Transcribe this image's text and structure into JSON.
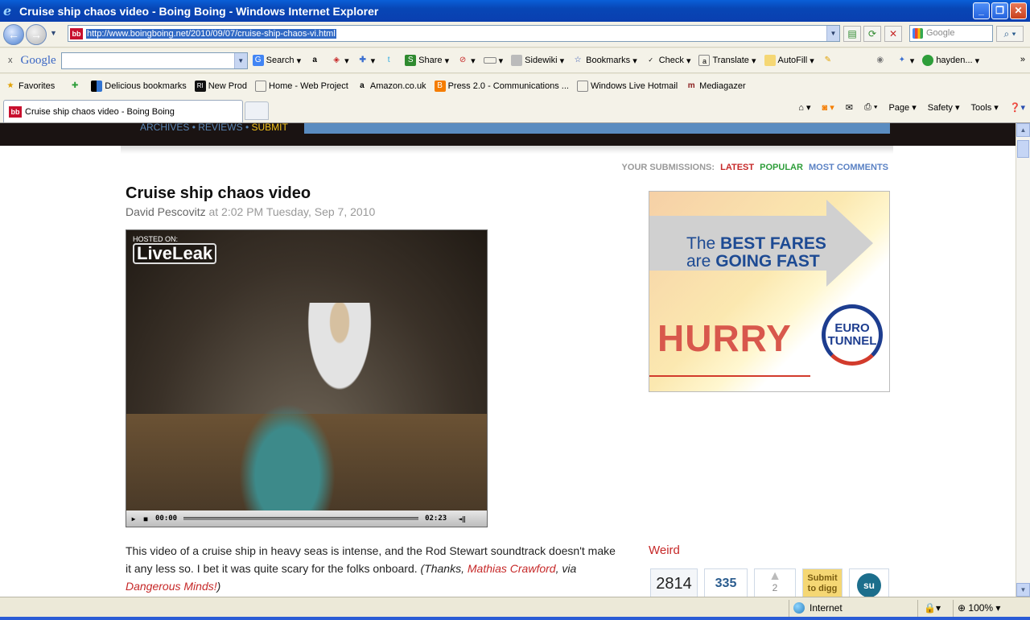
{
  "window": {
    "title": "Cruise ship chaos video - Boing Boing - Windows Internet Explorer"
  },
  "address": {
    "url": "http://www.boingboing.net/2010/09/07/cruise-ship-chaos-vi.html",
    "search_placeholder": "Google"
  },
  "google_toolbar": {
    "close": "x",
    "brand": "Google",
    "items": [
      "Search",
      "Share",
      "Sidewiki",
      "Bookmarks",
      "Check",
      "Translate",
      "AutoFill",
      "hayden..."
    ]
  },
  "favorites": {
    "label": "Favorites",
    "items": [
      "Delicious bookmarks",
      "New Prod",
      "Home - Web Project",
      "Amazon.co.uk",
      "Press 2.0 - Communications ...",
      "Windows Live Hotmail",
      "Mediagazer"
    ]
  },
  "tab": {
    "title": "Cruise ship chaos video - Boing Boing"
  },
  "commands": [
    "Page",
    "Safety",
    "Tools"
  ],
  "page": {
    "nav": {
      "archives": "ARCHIVES",
      "reviews": "REVIEWS",
      "submit": "SUBMIT",
      "dot": "•"
    },
    "submissions": {
      "label": "YOUR SUBMISSIONS:",
      "latest": "LATEST",
      "popular": "POPULAR",
      "most_comments": "MOST COMMENTS"
    },
    "post": {
      "title": "Cruise ship chaos video",
      "author": "David Pescovitz",
      "date": "at 2:02 PM Tuesday, Sep 7, 2010",
      "video": {
        "hosted": "HOSTED ON:",
        "brand": "LiveLeak",
        "time_elapsed": "00:00",
        "time_total": "02:23"
      },
      "body": "This video of a cruise ship in heavy seas is intense, and the Rod Stewart soundtrack doesn't make it any less so. I bet it was quite scary for the folks onboard.",
      "thanks_prefix": "(Thanks,",
      "thanks_name": "Mathias Crawford",
      "thanks_mid": ", via",
      "thanks_source": "Dangerous Minds!",
      "thanks_suffix": ")"
    },
    "ad": {
      "line1_a": "The",
      "line1_b": "BEST FARES",
      "line2_a": "are",
      "line2_b": "GOING FAST",
      "hurry": "HURRY",
      "logo_1": "EURO",
      "logo_2": "TUNNEL"
    },
    "category": "Weird",
    "counters": {
      "count_1": "2814",
      "count_2": "335",
      "votes": "2",
      "digg_1": "Submit",
      "digg_2": "to digg",
      "su": "su"
    }
  },
  "status": {
    "zone": "Internet",
    "zoom": "100%"
  },
  "colors": {
    "accent_red": "#c62828",
    "link_blue": "#5a86b5",
    "title_blue": "#0a5fd8"
  }
}
